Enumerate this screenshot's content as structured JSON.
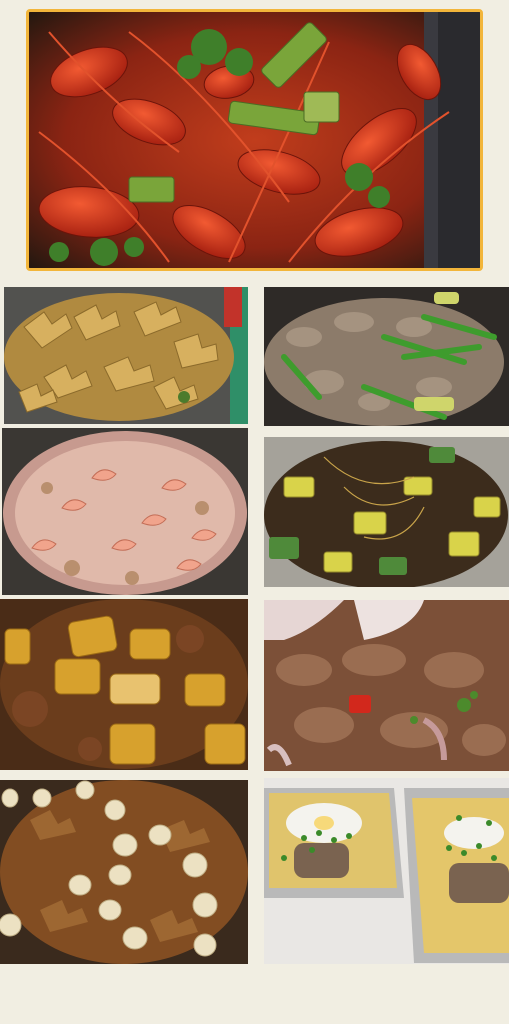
{
  "collage": {
    "background_color": "#f1eee2",
    "frame_color": "#f2b53a",
    "photos": [
      {
        "id": "hero",
        "subject": "crawfish",
        "colors": [
          "#b8321b",
          "#6f9a3a",
          "#2b1a12"
        ]
      },
      {
        "id": "p1",
        "subject": "chicken-feet",
        "colors": [
          "#b99243",
          "#d9b260",
          "#4a4a48"
        ]
      },
      {
        "id": "p2",
        "subject": "stir-fried-greens-and-meat",
        "colors": [
          "#7a6a58",
          "#3f8a2f",
          "#a79684"
        ]
      },
      {
        "id": "p3",
        "subject": "shrimp-cream-dish",
        "colors": [
          "#d9a7a0",
          "#e6c4b7",
          "#b98b7f"
        ]
      },
      {
        "id": "p4",
        "subject": "vegetable-stir-fry",
        "colors": [
          "#4b5a27",
          "#cfcf3a",
          "#2f2417"
        ]
      },
      {
        "id": "p5",
        "subject": "potato-stew",
        "colors": [
          "#7f4a1d",
          "#d39a2b",
          "#4a2b13"
        ]
      },
      {
        "id": "p6",
        "subject": "beef-with-onion",
        "colors": [
          "#6a4630",
          "#9c7053",
          "#e9d9d5"
        ]
      },
      {
        "id": "p7",
        "subject": "quail-egg-stew",
        "colors": [
          "#7f4e22",
          "#e9dec0",
          "#5e3415"
        ]
      },
      {
        "id": "p8",
        "subject": "egg-trays",
        "colors": [
          "#e8e6e2",
          "#d7c17c",
          "#b0b0b0"
        ]
      }
    ]
  }
}
